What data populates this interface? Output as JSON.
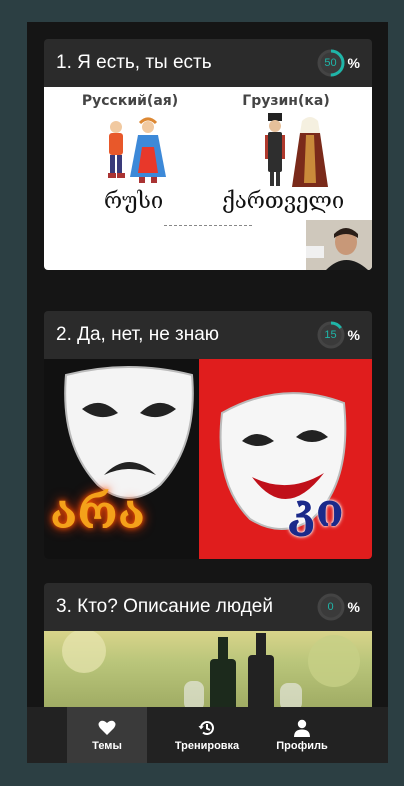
{
  "topics": [
    {
      "title": "1. Я есть, ты есть",
      "progress_value": "50",
      "progress_fraction": 0.5,
      "percent_sign": "%",
      "image": {
        "left_label": "Русский(ая)",
        "right_label": "Грузин(ка)",
        "left_word": "რუსი",
        "right_word": "ქართველი"
      }
    },
    {
      "title": "2. Да, нет, не знаю",
      "progress_value": "15",
      "progress_fraction": 0.15,
      "percent_sign": "%",
      "image": {
        "left_word": "არა",
        "right_word": "კი"
      }
    },
    {
      "title": "3. Кто? Описание людей",
      "progress_value": "0",
      "progress_fraction": 0,
      "percent_sign": "%"
    }
  ],
  "nav": {
    "items": [
      {
        "label": "Темы",
        "icon": "heart-icon",
        "active": true
      },
      {
        "label": "Тренировка",
        "icon": "history-icon",
        "active": false
      },
      {
        "label": "Профиль",
        "icon": "user-icon",
        "active": false
      }
    ]
  },
  "colors": {
    "accent": "#1fb5a8",
    "page_background": "#2c3f43",
    "app_background": "#151515",
    "card_background": "#2b2b2b"
  }
}
